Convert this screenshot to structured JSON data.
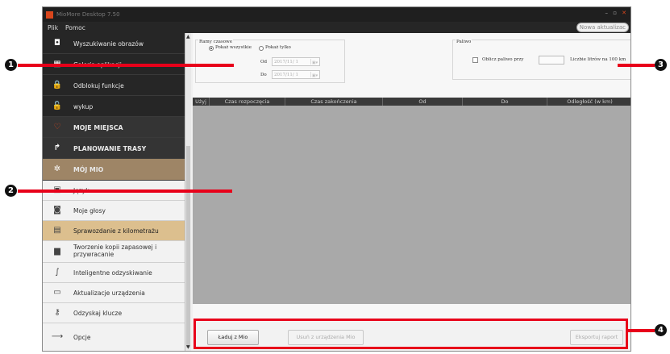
{
  "app": {
    "title": "MioMore Desktop 7.50",
    "menu": [
      "Plik",
      "Pomoc"
    ],
    "update_button": "Nowa aktualizac",
    "window_controls": [
      "–",
      "▫",
      "✕"
    ]
  },
  "sidebar": {
    "items": [
      {
        "label": "Wyszukiwanie obrazów",
        "icon": "camera-icon",
        "glyph": "◘"
      },
      {
        "label": "Galeria aplikacji",
        "icon": "grid-icon",
        "glyph": "▦"
      },
      {
        "label": "Odblokuj funkcje",
        "icon": "lock-icon",
        "glyph": "🔒"
      },
      {
        "label": "wykup",
        "icon": "lock-pro-icon",
        "glyph": "🔓"
      },
      {
        "label": "MOJE MIEJSCA",
        "icon": "heart-icon",
        "glyph": "♡"
      },
      {
        "label": "PLANOWANIE TRASY",
        "icon": "route-icon",
        "glyph": "↱"
      },
      {
        "label": "MÓJ MIO",
        "icon": "gear-icon",
        "glyph": "✲"
      },
      {
        "label": "Język",
        "icon": "language-icon",
        "glyph": "▣"
      },
      {
        "label": "Moje głosy",
        "icon": "voices-icon",
        "glyph": "◙"
      },
      {
        "label": "Sprawozdanie z kilometrażu",
        "icon": "odometer-icon",
        "glyph": "▤"
      },
      {
        "label": "Tworzenie kopii zapasowej i przywracanie",
        "icon": "backup-icon",
        "glyph": "▆"
      },
      {
        "label": "Inteligentne odzyskiwanie",
        "icon": "recovery-icon",
        "glyph": "∫"
      },
      {
        "label": "Aktualizacje urządzenia",
        "icon": "device-update-icon",
        "glyph": "▭"
      },
      {
        "label": "Odzyskaj klucze",
        "icon": "key-icon",
        "glyph": "⚷"
      },
      {
        "label": "Opcje",
        "icon": "options-icon",
        "glyph": "⟶"
      }
    ]
  },
  "time_range": {
    "title": "Ramy czasowe",
    "show_all": "Pokaż wszystkie",
    "show_only": "Pokaż tylko",
    "from_label": "Od",
    "to_label": "Do",
    "from_value": "2017/11/ 1",
    "to_value": "2017/11/ 1"
  },
  "fuel": {
    "title": "Paliwo",
    "checkbox_label": "Oblicz paliwo przy",
    "unit_label": "Liczbie litrów na 100 km"
  },
  "table": {
    "headers": [
      "Użyj",
      "Czas rozpoczęcia",
      "Czas zakończenia",
      "Od",
      "Do",
      "Odległość (w km)"
    ]
  },
  "buttons": {
    "load": "Ładuj z Mio",
    "delete": "Usuń z urządzenia Mio",
    "export": "Eksportuj raport"
  },
  "callouts": [
    "1",
    "2",
    "3",
    "4"
  ],
  "colors": {
    "callout": "#e8001a",
    "accent_active": "#9e8566",
    "selected_item": "#dcbf8e",
    "sidebar_bg": "#262626"
  }
}
